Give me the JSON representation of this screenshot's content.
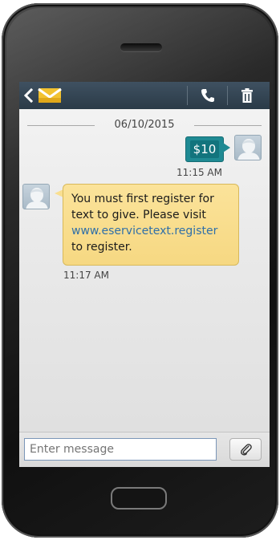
{
  "conversation": {
    "date": "06/10/2015",
    "sent": {
      "text": "$10",
      "time": "11:15 AM"
    },
    "received": {
      "text_before": "You must first register for text to give. Please visit ",
      "link": "www.eservicetext.register",
      "text_after": " to register.",
      "time": "11:17 AM"
    }
  },
  "composer": {
    "placeholder": "Enter message"
  },
  "icons": {
    "back": "back-arrow-icon",
    "mail": "envelope-icon",
    "call": "phone-icon",
    "delete": "trash-icon",
    "attach": "paperclip-icon",
    "avatar": "user-avatar-icon"
  },
  "colors": {
    "topbar": "#34495a",
    "sent_bubble": "#1f8a93",
    "received_bubble": "#f8dc8a",
    "link": "#2f6fa8"
  }
}
